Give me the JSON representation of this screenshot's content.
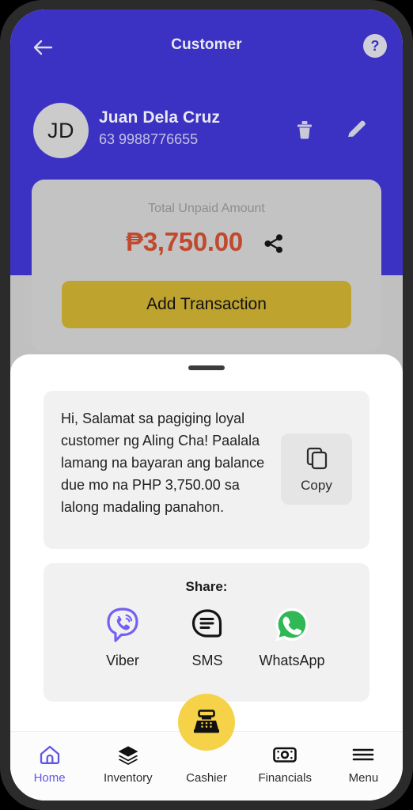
{
  "header": {
    "title": "Customer",
    "back_icon": "arrow-left-icon",
    "help_icon": "question-mark-icon",
    "help_glyph": "?"
  },
  "customer": {
    "initials": "JD",
    "name": "Juan Dela Cruz",
    "phone": "63 9988776655",
    "delete_icon": "trash-icon",
    "edit_icon": "pencil-icon"
  },
  "unpaid_card": {
    "label": "Total Unpaid Amount",
    "amount": "₱3,750.00",
    "amount_color": "#c0492e",
    "share_icon": "share-nodes-icon",
    "add_transaction_label": "Add Transaction",
    "add_transaction_color": "#bfa32f"
  },
  "message": {
    "text": "Hi, Salamat sa pagiging loyal customer ng Aling Cha! Paalala lamang na bayaran ang balance due mo na PHP 3,750.00 sa lalong madaling panahon.",
    "copy_label": "Copy",
    "copy_icon": "copy-icon"
  },
  "share": {
    "heading": "Share:",
    "options": [
      {
        "label": "Viber",
        "icon": "viber-icon",
        "color": "#7360f2"
      },
      {
        "label": "SMS",
        "icon": "sms-bubble-icon",
        "color": "#111111"
      },
      {
        "label": "WhatsApp",
        "icon": "whatsapp-icon",
        "color": "#2fb855"
      }
    ]
  },
  "bottom_nav": {
    "active_color": "#6155e8",
    "fab": {
      "label": "Cashier",
      "icon": "cash-register-icon",
      "color": "#f6d249"
    },
    "items": [
      {
        "label": "Home",
        "icon": "home-icon",
        "active": true
      },
      {
        "label": "Inventory",
        "icon": "layers-icon",
        "active": false
      },
      {
        "label": "Cashier",
        "icon": "cash-register-icon",
        "active": false
      },
      {
        "label": "Financials",
        "icon": "banknote-icon",
        "active": false
      },
      {
        "label": "Menu",
        "icon": "hamburger-menu-icon",
        "active": false
      }
    ]
  },
  "colors": {
    "header_blue": "#3b32c4",
    "dim_backdrop": "#c0c0c0",
    "sheet_white": "#ffffff"
  }
}
